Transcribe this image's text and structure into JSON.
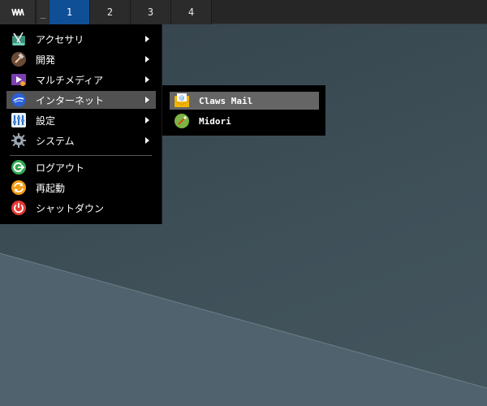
{
  "panel": {
    "launcher_icon": "menu-launcher-icon",
    "show_desktop_label": "_",
    "workspaces": [
      "1",
      "2",
      "3",
      "4"
    ],
    "active_workspace": "1"
  },
  "menu": {
    "items": [
      {
        "label": "アクセサリ",
        "icon": "accessories-icon",
        "submenu": true
      },
      {
        "label": "開発",
        "icon": "development-icon",
        "submenu": true
      },
      {
        "label": "マルチメディア",
        "icon": "multimedia-icon",
        "submenu": true
      },
      {
        "label": "インターネット",
        "icon": "internet-icon",
        "submenu": true,
        "highlighted": true
      },
      {
        "label": "設定",
        "icon": "settings-icon",
        "submenu": true
      },
      {
        "label": "システム",
        "icon": "system-icon",
        "submenu": true
      }
    ],
    "actions": [
      {
        "label": "ログアウト",
        "icon": "logout-icon"
      },
      {
        "label": "再起動",
        "icon": "reboot-icon"
      },
      {
        "label": "シャットダウン",
        "icon": "shutdown-icon"
      }
    ]
  },
  "submenu": {
    "items": [
      {
        "label": "Claws Mail",
        "icon": "mail-icon",
        "highlighted": true
      },
      {
        "label": "Midori",
        "icon": "browser-icon"
      }
    ]
  },
  "colors": {
    "panel": "#262626",
    "active_workspace": "#0f4f96",
    "menu_bg": "#000000",
    "highlight": "#515151",
    "desktop": "#3d4d56"
  }
}
